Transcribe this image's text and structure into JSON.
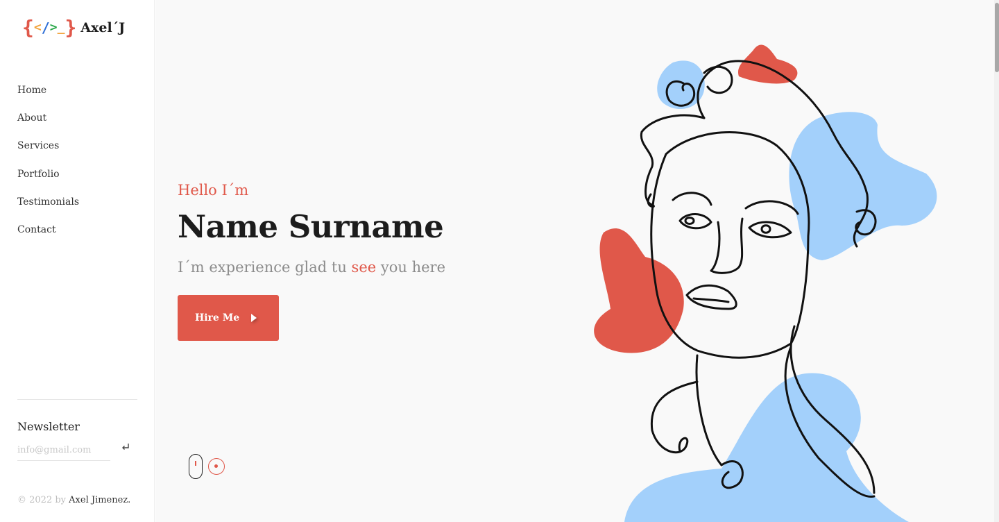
{
  "brand": {
    "logo_open": "{",
    "logo_lt": "<",
    "logo_slash": "/",
    "logo_gt": ">",
    "logo_under": "_",
    "logo_close": "}",
    "name": "Axel´J"
  },
  "nav": {
    "items": [
      {
        "label": "Home"
      },
      {
        "label": "About"
      },
      {
        "label": "Services"
      },
      {
        "label": "Portfolio"
      },
      {
        "label": "Testimonials"
      },
      {
        "label": "Contact"
      }
    ]
  },
  "newsletter": {
    "title": "Newsletter",
    "placeholder": "info@gmail.com",
    "submit_icon": "enter-arrow-icon"
  },
  "footer": {
    "copyright_prefix": "© 2022 by",
    "author": "Axel Jimenez."
  },
  "hero": {
    "greeting": "Hello I´m",
    "name": "Name Surname",
    "tagline_before": "I´m experience glad tu",
    "tagline_accent": "see",
    "tagline_after": "you here",
    "cta_label": "Hire Me"
  },
  "colors": {
    "accent": "#e0584a",
    "blob_blue": "#a3d0fb",
    "background": "#f9f9f9",
    "text_dark": "#1c1c1c"
  }
}
